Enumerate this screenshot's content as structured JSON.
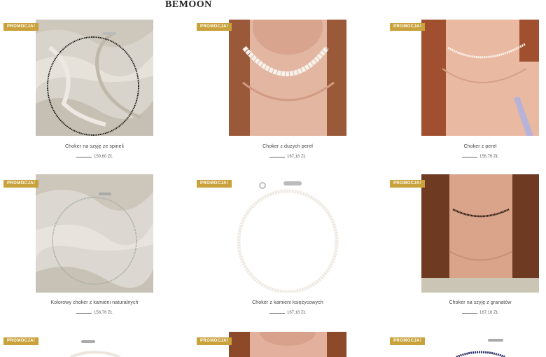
{
  "brand": "BEMOON",
  "badge_label": "PROMOCJA!",
  "products": [
    {
      "name": "Choker na szyję ze spineli",
      "price": "159,60 ZŁ",
      "image": "black-spinel-choker-on-silk"
    },
    {
      "name": "Choker z dużych pereł",
      "price": "167,16 ZŁ",
      "image": "large-pearl-choker-on-neck"
    },
    {
      "name": "Choker z pereł",
      "price": "158,76 ZŁ",
      "image": "small-pearl-choker-on-neck"
    },
    {
      "name": "Kolorowy choker z kamieni naturalnych",
      "price": "158,76 ZŁ",
      "image": "colorful-stone-choker-on-silk"
    },
    {
      "name": "Choker z kamieni księżycowych",
      "price": "167,16 ZŁ",
      "image": "moonstone-choker-on-white"
    },
    {
      "name": "Choker na szyję z granatów",
      "price": "167,16 ZŁ",
      "image": "garnet-choker-on-neck"
    },
    {
      "name": "",
      "price": "",
      "image": "pearl-choker-on-white"
    },
    {
      "name": "",
      "price": "",
      "image": "choker-on-neck"
    },
    {
      "name": "",
      "price": "",
      "image": "lapis-choker-on-white"
    }
  ]
}
